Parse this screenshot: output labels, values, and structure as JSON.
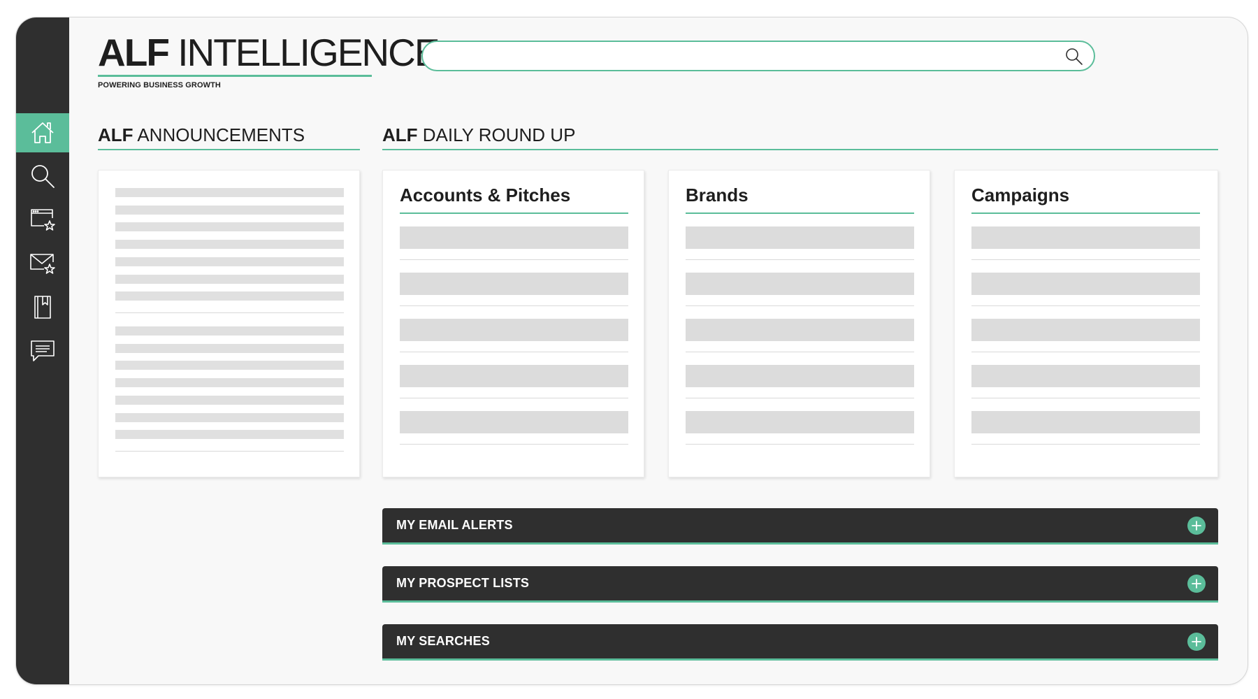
{
  "app": {
    "brand_bold": "ALF",
    "brand_light": "INTELLIGENCE",
    "tagline": "POWERING BUSINESS GROWTH"
  },
  "search": {
    "placeholder": "",
    "value": ""
  },
  "sidebar": {
    "items": [
      {
        "name": "home",
        "active": true
      },
      {
        "name": "search"
      },
      {
        "name": "saved-pages"
      },
      {
        "name": "email-alerts"
      },
      {
        "name": "bookmarks"
      },
      {
        "name": "messages"
      }
    ]
  },
  "announcements": {
    "heading_bold": "ALF",
    "heading_light": "ANNOUNCEMENTS"
  },
  "roundup": {
    "heading_bold": "ALF",
    "heading_light": "DAILY ROUND UP",
    "cards": [
      {
        "title": "Accounts & Pitches"
      },
      {
        "title": "Brands"
      },
      {
        "title": "Campaigns"
      }
    ]
  },
  "accordions": [
    {
      "label": "MY EMAIL ALERTS"
    },
    {
      "label": "MY PROSPECT LISTS"
    },
    {
      "label": "MY SEARCHES"
    }
  ],
  "colors": {
    "accent": "#5bbd9a",
    "sidebar": "#2f2f2f",
    "placeholder": "#dcdcdc"
  }
}
